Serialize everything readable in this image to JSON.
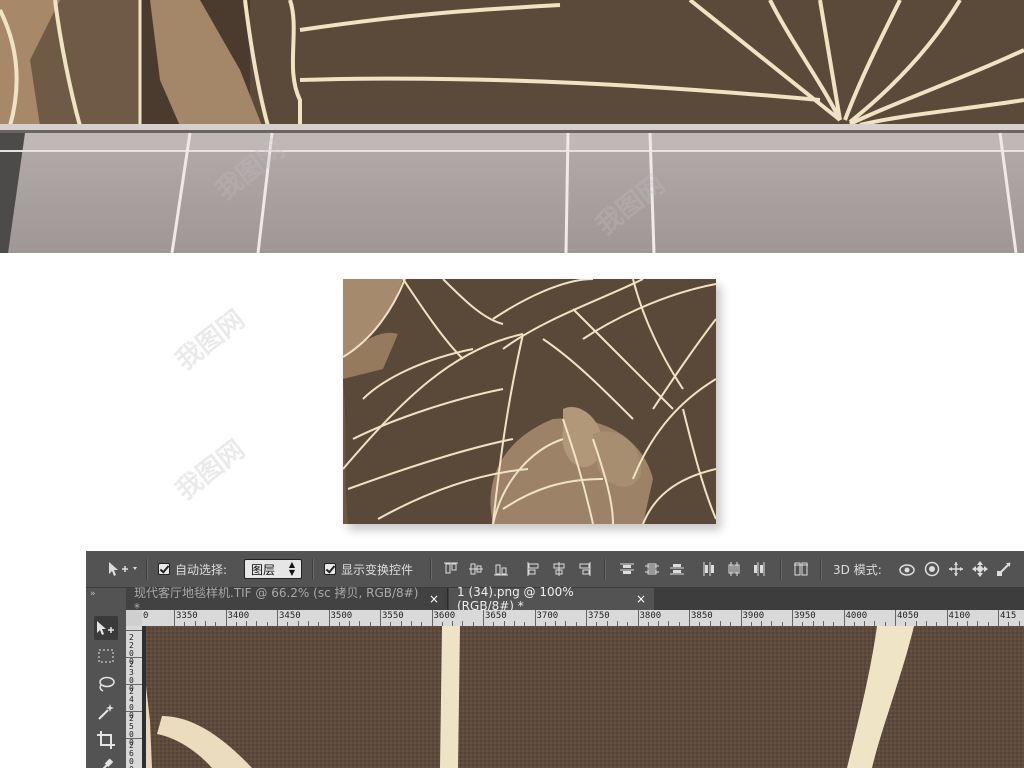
{
  "watermark": "我图网",
  "photoshop": {
    "options_bar": {
      "auto_select_label": "自动选择:",
      "auto_select_checked": true,
      "layer_dropdown_value": "图层",
      "show_transform_label": "显示变换控件",
      "show_transform_checked": true,
      "mode_3d_label": "3D 模式:"
    },
    "tabs": [
      {
        "label": "现代客厅地毯样机.TIF @ 66.2% (sc 拷贝, RGB/8#) *",
        "active": false
      },
      {
        "label": "1 (34).png @ 100%(RGB/8#) *",
        "active": true
      }
    ],
    "tab_close_glyph": "×",
    "ruler": {
      "labels": [
        "3350",
        "3400",
        "3450",
        "3500",
        "3550",
        "3600",
        "3650",
        "3700",
        "3750",
        "3800",
        "3850",
        "3900",
        "3950",
        "4000",
        "4050",
        "4100",
        "415"
      ],
      "first_partial": "0"
    },
    "ruler_v_labels": [
      [
        "2",
        "2",
        "0",
        "0"
      ],
      [
        "2",
        "3",
        "0",
        "0"
      ],
      [
        "2",
        "4",
        "0",
        "0"
      ],
      [
        "2",
        "5",
        "0",
        "0"
      ],
      [
        "2",
        "6",
        "0",
        "0"
      ]
    ],
    "tools": [
      "move-tool-icon",
      "marquee-tool-icon",
      "lasso-tool-icon",
      "magic-wand-icon",
      "crop-tool-icon",
      "eyedropper-icon"
    ]
  },
  "colors": {
    "rug_brown": "#5a4838",
    "leaf_line": "#efe3c4",
    "leaf_fill": "#9c8267",
    "ps_panel": "#535353",
    "ps_tabbar": "#3d3d3d"
  }
}
